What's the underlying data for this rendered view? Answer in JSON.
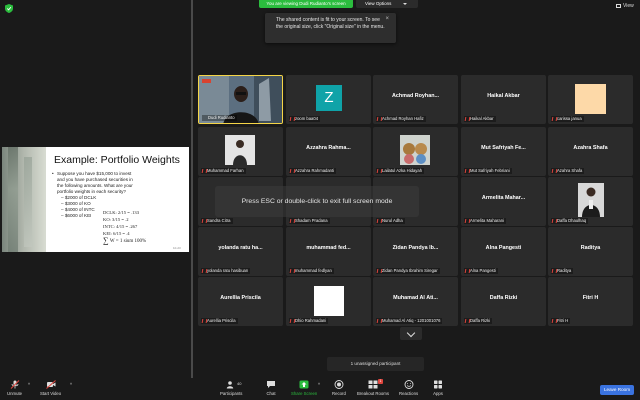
{
  "top": {
    "sharing_banner": "You are viewing Dudi Rudianto's screen",
    "view_options": "View Options",
    "view_button": "View"
  },
  "tooltip": {
    "text": "The shared content is fit to your screen. To see the original size, click \"Original size\" in the menu."
  },
  "slide": {
    "title": "Example: Portfolio Weights",
    "bullet": "Suppose you have $15,000 to invest and you have purchased securities in the following amounts. What are your portfolio weights in each security?",
    "items": [
      "$2000 of DCLK",
      "$3000 of KO",
      "$4000 of INTC",
      "$6000 of KEI"
    ],
    "calc": [
      "DCLK: 2/15 = .133",
      "KO: 3/15 = .2",
      "INTC: 4/15 = .267",
      "KEI: 6/15 = .4"
    ],
    "sum": "W = 1 sium 100%",
    "page": "10-23"
  },
  "tiles": [
    {
      "name": "",
      "label": "Dudi Rudianto",
      "muted": false,
      "kind": "video-main"
    },
    {
      "name": "",
      "label": "zoom baa04",
      "muted": true,
      "kind": "avatar-z"
    },
    {
      "name": "Achmad Royhan...",
      "label": "Achmad Royhan Hafiz",
      "muted": true,
      "kind": "text"
    },
    {
      "name": "Haikal Akbar",
      "label": "Haikal Akbar",
      "muted": true,
      "kind": "text"
    },
    {
      "name": "",
      "label": "carissa janua",
      "muted": true,
      "kind": "peach"
    },
    {
      "name": "",
      "label": "Muhammad Farhan",
      "muted": true,
      "kind": "photo-farhan"
    },
    {
      "name": "Azzahra Rahma...",
      "label": "Azzahra Rahmadanti",
      "muted": true,
      "kind": "text"
    },
    {
      "name": "",
      "label": "Lailatul Azka Hidayah",
      "muted": true,
      "kind": "photo-bears"
    },
    {
      "name": "Mut Safriyah Fe...",
      "label": "Mut Safriyah Febriani",
      "muted": true,
      "kind": "text"
    },
    {
      "name": "Azahra Shafa",
      "label": "Azahra Shafa",
      "muted": true,
      "kind": "text"
    },
    {
      "name": "",
      "label": "Sandra Citra",
      "muted": true,
      "kind": "dark"
    },
    {
      "name": "",
      "label": "Shadam Pradana",
      "muted": true,
      "kind": "dark"
    },
    {
      "name": "",
      "label": "Nurul Adha",
      "muted": true,
      "kind": "dark"
    },
    {
      "name": "Armelita Mahar...",
      "label": "Armelita Maharani",
      "muted": true,
      "kind": "text"
    },
    {
      "name": "",
      "label": "Daffa Dhaulhaq",
      "muted": true,
      "kind": "photo-daffa"
    },
    {
      "name": "yolanda ratu ha...",
      "label": "yolanda ratu hasibuan",
      "muted": true,
      "kind": "text"
    },
    {
      "name": "muhammad fed...",
      "label": "muhammad fedlyan",
      "muted": true,
      "kind": "text"
    },
    {
      "name": "Zidan Pandya Ib...",
      "label": "Zidan Pandya Ibrahim Siregar",
      "muted": true,
      "kind": "text"
    },
    {
      "name": "Alna Pangesti",
      "label": "Alna Pangesti",
      "muted": true,
      "kind": "text"
    },
    {
      "name": "Raditya",
      "label": "Raditya",
      "muted": true,
      "kind": "text"
    },
    {
      "name": "Aurellia Priscila",
      "label": "Aurellia Priscila",
      "muted": true,
      "kind": "text"
    },
    {
      "name": "",
      "label": "Dhio Rahmadani",
      "muted": true,
      "kind": "white"
    },
    {
      "name": "Muhamad Al Ati...",
      "label": "Muhamad Al Atiq - 1201001076",
      "muted": true,
      "kind": "text"
    },
    {
      "name": "Daffa Rizki",
      "label": "Daffa Rizki",
      "muted": true,
      "kind": "text"
    },
    {
      "name": "Fitri H",
      "label": "Fitri H",
      "muted": true,
      "kind": "text"
    }
  ],
  "overlay": {
    "esc_text": "Press ESC or double-click to exit full screen mode"
  },
  "unassigned": "1 unassigned participant",
  "toolbar": {
    "unmute": "Unmute",
    "start_video": "Start Video",
    "participants": "Participants",
    "participants_count": "40",
    "chat": "Chat",
    "share_screen": "Share Screen",
    "record": "Record",
    "breakout_rooms": "Breakout Rooms",
    "breakout_badge": "1",
    "reactions": "Reactions",
    "apps": "Apps",
    "leave": "Leave Room"
  },
  "colors": {
    "accent_green": "#2bbd3e",
    "leave_blue": "#3a73e0",
    "active_speaker": "#f5d547",
    "muted_red": "#e0453d",
    "avatar_teal": "#0fa3a8",
    "avatar_peach": "#fdd9a8"
  }
}
